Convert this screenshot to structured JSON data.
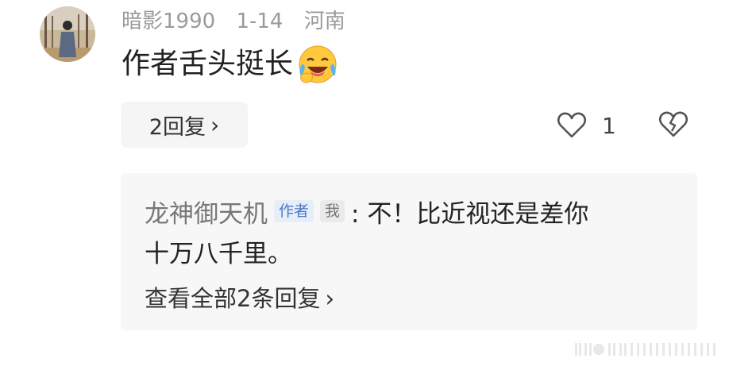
{
  "comment": {
    "username": "暗影1990",
    "date": "1-14",
    "location": "河南",
    "text": "作者舌头挺长",
    "emoji": "laughing-crying-emoji",
    "reply_button_label": "2回复",
    "like_count": "1"
  },
  "reply": {
    "author": "龙神御天机",
    "author_tag": "作者",
    "me_tag": "我",
    "text_line1": ": 不！比近视还是差你",
    "text_line2": "十万八千里。",
    "view_all_label": "查看全部2条回复"
  },
  "colors": {
    "meta_gray": "#9a9a9a",
    "author_tag_blue": "#4a78c4",
    "reply_bg": "#f7f7f7"
  }
}
